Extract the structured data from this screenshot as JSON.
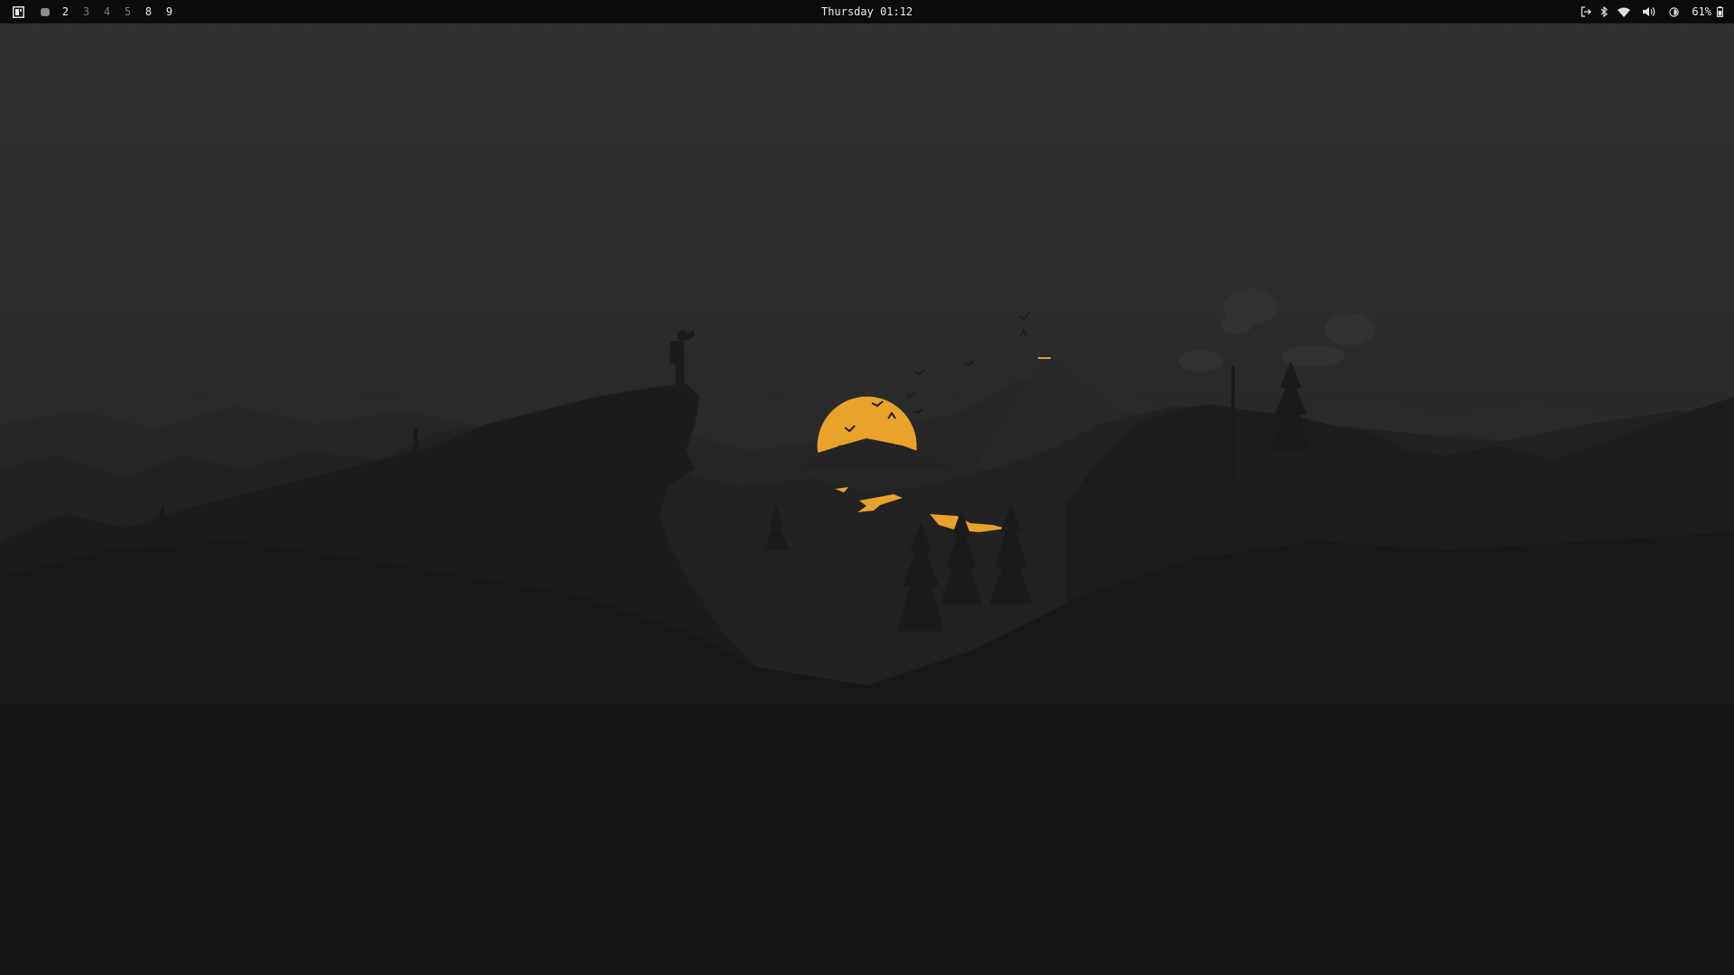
{
  "topbar": {
    "workspaces": [
      {
        "label": "",
        "state": "active"
      },
      {
        "label": "2",
        "state": "occupied"
      },
      {
        "label": "3",
        "state": "empty"
      },
      {
        "label": "4",
        "state": "empty"
      },
      {
        "label": "5",
        "state": "empty"
      },
      {
        "label": "8",
        "state": "occupied"
      },
      {
        "label": "9",
        "state": "occupied"
      }
    ],
    "clock": "Thursday 01:12",
    "tray": {
      "icons": [
        "logout-icon",
        "bluetooth-icon",
        "wifi-icon",
        "volume-icon",
        "brightness-icon"
      ],
      "battery_percent": "61%"
    }
  },
  "colors": {
    "bar_background": "#0b0b0b",
    "sun": "#e9a22a",
    "sky_top": "#2f2f2f",
    "foreground_dark": "#161616"
  }
}
